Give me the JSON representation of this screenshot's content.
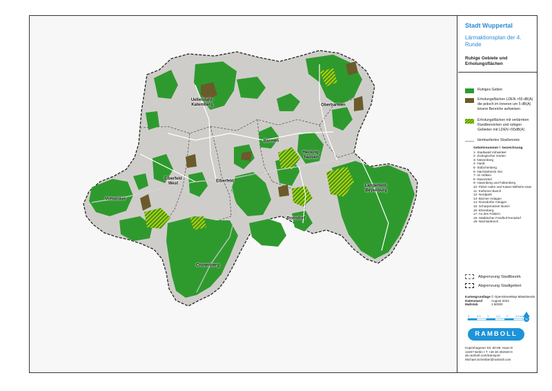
{
  "districts": [
    {
      "key": "uellendahl",
      "label": "Uellendahl-\nKatemberg"
    },
    {
      "key": "oberbarmen",
      "label": "Oberbarmen"
    },
    {
      "key": "barmen",
      "label": "Barmen"
    },
    {
      "key": "heckinghausen",
      "label": "Hecking-\nhausen"
    },
    {
      "key": "elberfeld_west",
      "label": "Elberfeld\nWest"
    },
    {
      "key": "elberfeld",
      "label": "Elberfeld"
    },
    {
      "key": "vohwinkel",
      "label": "Vohwinkel"
    },
    {
      "key": "langerfeld",
      "label": "Langerfeld-\nBeyenburg"
    },
    {
      "key": "ronsdorf",
      "label": "Ronsdorf"
    },
    {
      "key": "cronenberg",
      "label": "Cronenberg"
    }
  ],
  "legend": {
    "title": "Stadt Wuppertal",
    "subtitle": "Lärmaktionsplan der 4. Runde",
    "plan_title": "Ruhige Gebiete und Erholungsflächen",
    "items": [
      {
        "label": "Ruhiges Gebiet",
        "swatch": "green"
      },
      {
        "label": "Erholungsflächen LDEN >55 dB(A) die jedoch im Inneren um 5 dB(A) leisere Bereiche aufweisen",
        "swatch": "brown"
      },
      {
        "label": "Erholungsflächen mit verlärmten Randbereichen und ruhigen Gebieten mit LDEN <55dB(A)",
        "swatch": "hatch"
      },
      {
        "label": "lärmkartiertes Straßennetz",
        "swatch": "road"
      }
    ],
    "area_heading": "Gebietsnummer / -bezeichnung",
    "areas": [
      "1- Stadtwald Vohwinkel",
      "2- Zoologischer Garten",
      "3- Nützenberg",
      "4- Hardt",
      "5- Stübchenberg",
      "6- Nächstebreck Ost",
      "7- Im Hölken",
      "8- Dasnöckel",
      "9- Hasenberg und Falkenberg",
      "10- Pirker Hahn und Kaiser-Wilhelm-Hain",
      "11- Kothener Busch",
      "12- Nordpark",
      "13- Barmer Anlagen",
      "14- Ronsdorfer Anlagen",
      "15- Scharpenacker Busch",
      "16- Ehrenberg",
      "17- An den Feldern",
      "18- Städtischer Friedhof Ronsdorf",
      "19- Nächstebreck"
    ],
    "boundaries": {
      "district": "Abgrenzung Stadtbezirk",
      "city": "Abgrenzung Stadtgebiet"
    },
    "basis": [
      {
        "label": "Kartengrundlage",
        "value": "© OpenStreetMap-Mitwirkende"
      },
      {
        "label": "Datenstand",
        "value": "August 2023"
      },
      {
        "label": "Maßstab",
        "value": "1:50000"
      }
    ],
    "scale_ticks": [
      "0",
      "0,5",
      "1",
      "1,5",
      "2",
      "2,5 km"
    ],
    "north_label": "N",
    "logo": "RAMBOLL",
    "contact": [
      "Kopenhagener Str. 60-68, Haus D",
      "13407 Berlin • T +49 30 302020-0",
      "de.ramboll.com/transport",
      "Michael.Schreiber@ramboll.com"
    ]
  },
  "colors": {
    "quiet_area": "#2e9a2e",
    "recreation_inner_quiet": "#6b5a2a",
    "recreation_hatch": "#b6d400",
    "city_fill": "#cfcdc9",
    "road": "#ffffff",
    "accent": "#1e94d8"
  }
}
